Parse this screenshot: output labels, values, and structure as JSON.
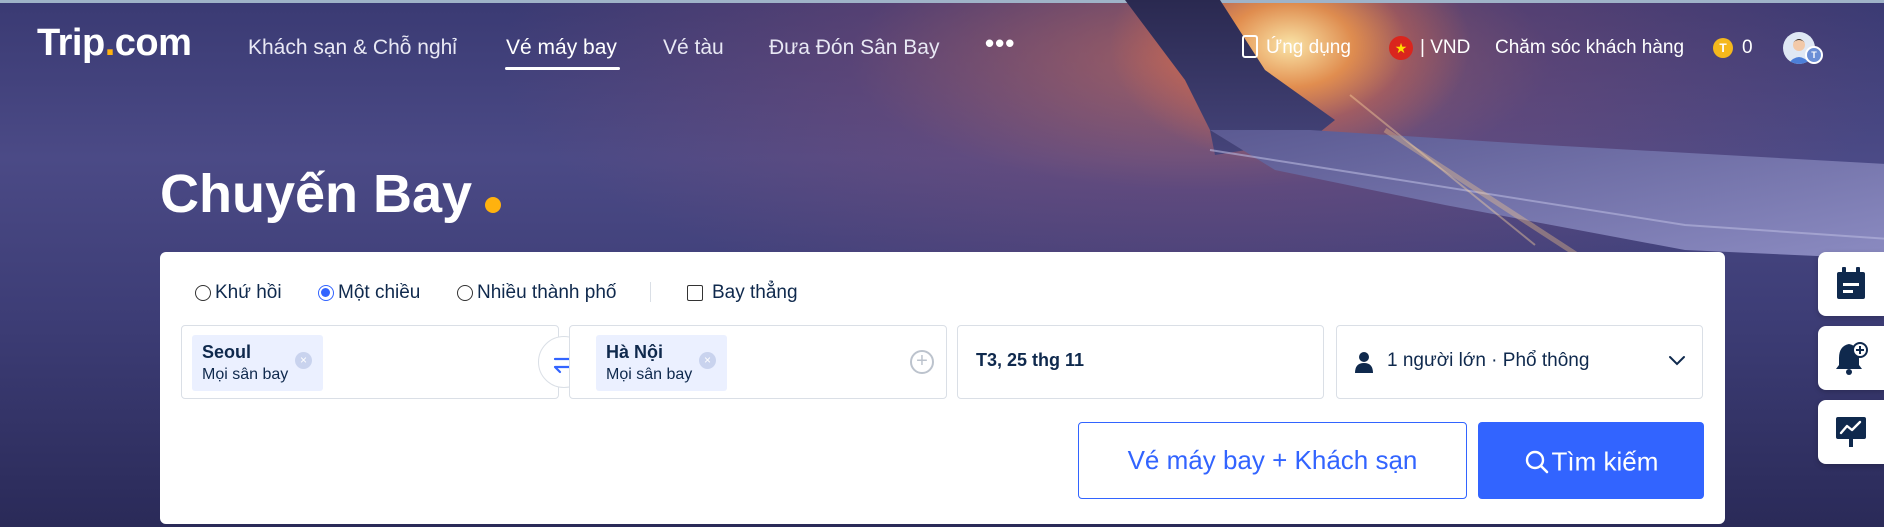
{
  "header": {
    "logo_text": "Trip",
    "logo_dot": ".",
    "logo_suffix": "com",
    "nav": [
      {
        "label": "Khách sạn & Chỗ nghỉ"
      },
      {
        "label": "Vé máy bay",
        "active": true
      },
      {
        "label": "Vé tàu"
      },
      {
        "label": "Đưa Đón Sân Bay"
      }
    ],
    "more_label": "•••",
    "app_label": "Ứng dụng",
    "currency_label": "| VND",
    "support_label": "Chăm sóc khách hàng",
    "coins_label": "0",
    "coin_symbol": "T",
    "flag_symbol": "★",
    "avatar_badge": "T"
  },
  "hero": {
    "title": "Chuyến Bay"
  },
  "search": {
    "trip_types": [
      {
        "label": "Khứ hồi",
        "checked": false
      },
      {
        "label": "Một chiều",
        "checked": true
      },
      {
        "label": "Nhiều thành phố",
        "checked": false
      }
    ],
    "nonstop_label": "Bay thẳng",
    "nonstop_checked": false,
    "origin": {
      "city": "Seoul",
      "airports": "Mọi sân bay"
    },
    "destination": {
      "city": "Hà Nội",
      "airports": "Mọi sân bay"
    },
    "chip_remove": "×",
    "add_symbol": "+",
    "date": "T3, 25 thg 11",
    "passengers": "1 người lớn · Phổ thông",
    "combo_button": "Vé máy bay + Khách sạn",
    "search_button": "Tìm kiếm"
  },
  "colors": {
    "accent": "#3264ff",
    "brand_dot": "#ffb20e",
    "text_dark": "#0f294d"
  }
}
